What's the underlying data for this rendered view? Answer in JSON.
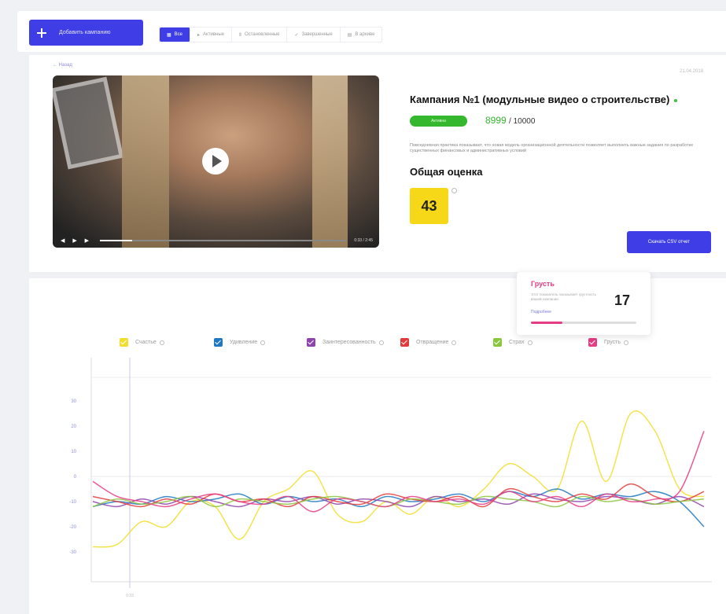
{
  "toolbar": {
    "add_label": "Добавить кампанию",
    "filters": [
      {
        "label": "Все",
        "icon": "grid-icon",
        "active": true
      },
      {
        "label": "Активные",
        "icon": "play-icon",
        "active": false
      },
      {
        "label": "Остановленные",
        "icon": "pause-icon",
        "active": false
      },
      {
        "label": "Завершенные",
        "icon": "check-icon",
        "active": false
      },
      {
        "label": "В архиве",
        "icon": "archive-icon",
        "active": false
      }
    ]
  },
  "campaign": {
    "back_label": "← Назад",
    "date": "21.04.2018",
    "title": "Кампания №1 (модульные видео о строительстве)",
    "status": "Активна",
    "views": "8999",
    "views_total": "/ 10000",
    "description": "Повседневная практика показывает, что новая модель организационной деятельности позволяет выполнить важные задания по разработке существенных финансовых и административных условий",
    "score_heading": "Общая оценка",
    "score": "43",
    "csv_label": "Скачать CSV отчет",
    "video": {
      "time": "0:33 / 2:45",
      "progress": 0.13
    }
  },
  "tooltip": {
    "title": "Грусть",
    "description": "Этот показатель показывает грустность вашей компании",
    "link": "Подробнее",
    "value": "17",
    "level": 0.3
  },
  "chart_data": {
    "type": "line",
    "title": "",
    "xlabel": "",
    "ylabel": "",
    "ylim": [
      -30,
      30
    ],
    "yticks": [
      "30",
      "20",
      "10",
      "0",
      "-10",
      "-20",
      "-30"
    ],
    "xtick_label": "0:33",
    "x": [
      0,
      4,
      8,
      12,
      16,
      20,
      24,
      28,
      32,
      36,
      40,
      44,
      48,
      52,
      56,
      60,
      64,
      68,
      72,
      76,
      80,
      84,
      88,
      92,
      96,
      100
    ],
    "grid": "horizontal",
    "legend_position": "top",
    "series": [
      {
        "name": "Счастье",
        "color": "#f2de2e",
        "values": [
          -28,
          -27,
          -18,
          -20,
          -10,
          -12,
          -25,
          -10,
          -5,
          2,
          -15,
          -18,
          -10,
          -15,
          -8,
          -12,
          -5,
          5,
          0,
          -5,
          22,
          -2,
          25,
          18,
          -5,
          -8
        ]
      },
      {
        "name": "Удивление",
        "color": "#1f78c1",
        "values": [
          -12,
          -10,
          -11,
          -8,
          -10,
          -9,
          -7,
          -11,
          -8,
          -10,
          -9,
          -12,
          -8,
          -10,
          -9,
          -7,
          -10,
          -6,
          -8,
          -5,
          -9,
          -7,
          -8,
          -6,
          -10,
          -20
        ]
      },
      {
        "name": "Заинтересованность",
        "color": "#8e44ad",
        "values": [
          -10,
          -12,
          -9,
          -11,
          -8,
          -10,
          -12,
          -9,
          -10,
          -8,
          -11,
          -9,
          -10,
          -12,
          -8,
          -10,
          -9,
          -11,
          -7,
          -9,
          -10,
          -8,
          -9,
          -11,
          -8,
          -12
        ]
      },
      {
        "name": "Отвращение",
        "color": "#e23b3b",
        "values": [
          -8,
          -10,
          -12,
          -9,
          -11,
          -7,
          -10,
          -9,
          -12,
          -8,
          -10,
          -11,
          -7,
          -9,
          -10,
          -8,
          -12,
          -5,
          -8,
          -10,
          -7,
          -9,
          -3,
          -8,
          -10,
          -6
        ]
      },
      {
        "name": "Страх",
        "color": "#8cc63f",
        "values": [
          -12,
          -9,
          -11,
          -10,
          -8,
          -12,
          -9,
          -10,
          -11,
          -9,
          -8,
          -10,
          -12,
          -9,
          -10,
          -11,
          -8,
          -9,
          -10,
          -12,
          -8,
          -10,
          -9,
          -11,
          -10,
          -9
        ]
      },
      {
        "name": "Грусть",
        "color": "#e63c84",
        "values": [
          -2,
          -8,
          -10,
          -12,
          -9,
          -7,
          -10,
          -11,
          -8,
          -14,
          -9,
          -10,
          -12,
          -8,
          -10,
          -9,
          -11,
          -6,
          -10,
          -8,
          -12,
          -7,
          -10,
          -9,
          -6,
          18
        ]
      }
    ]
  }
}
